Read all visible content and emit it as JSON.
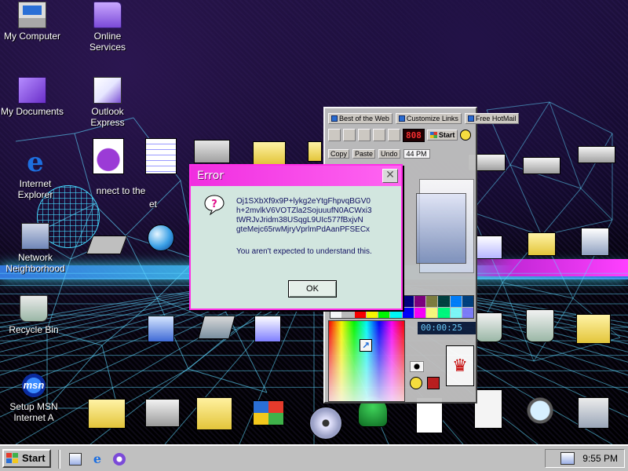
{
  "desktop": {
    "icons": [
      {
        "label_lines": [
          "My Computer"
        ],
        "icon": "my-computer-icon"
      },
      {
        "label_lines": [
          "Online",
          "Services"
        ],
        "icon": "folder-icon"
      },
      {
        "label_lines": [
          "My Documents"
        ],
        "icon": "my-documents-icon"
      },
      {
        "label_lines": [
          "Outlook",
          "Express"
        ],
        "icon": "outlook-express-icon"
      },
      {
        "label_lines": [
          "Internet",
          "Explorer"
        ],
        "icon": "internet-explorer-icon"
      },
      {
        "label_lines": [
          "Network",
          "Neighborhood"
        ],
        "icon": "network-neighborhood-icon"
      },
      {
        "label_lines": [
          "Recycle Bin"
        ],
        "icon": "recycle-bin-icon"
      },
      {
        "label_lines": [
          "Setup MSN",
          "Internet A"
        ],
        "icon": "msn-icon"
      }
    ],
    "partial_label": "nnect to the",
    "partial_label_2": "et"
  },
  "ie_toolbar": {
    "links": [
      "Best of the Web",
      "Customize Links",
      "Free HotMail"
    ],
    "led_value": "808",
    "start_label": "Start",
    "buttons": [
      "Copy",
      "Paste",
      "Undo"
    ],
    "clock": "44 PM",
    "timer": "00:00:25"
  },
  "error_dialog": {
    "title": "Error",
    "code_lines": "Oj1SXbXf9x9P+lykg2eYtgFhpvqBGV0\nh+2mvlkV6VOTZla2SojuuufN0ACWxi3\ntWRJvJridm38USqgL9UIc577fBxjvN\ngteMejc65rwMjryVprlmPdAanPFSECx",
    "message": "You aren't expected to understand this.",
    "ok_label": "OK",
    "close_glyph": "✕"
  },
  "taskbar": {
    "start_label": "Start",
    "quick_launch": [
      "show-desktop-icon",
      "internet-explorer-icon",
      "channels-icon"
    ],
    "clock": "9:55 PM"
  },
  "colors": {
    "dialog_title": "#f02ee0",
    "dialog_body": "#d2e6df",
    "horizon": "#46d8ff",
    "taskbar": "#c0c0c0"
  }
}
